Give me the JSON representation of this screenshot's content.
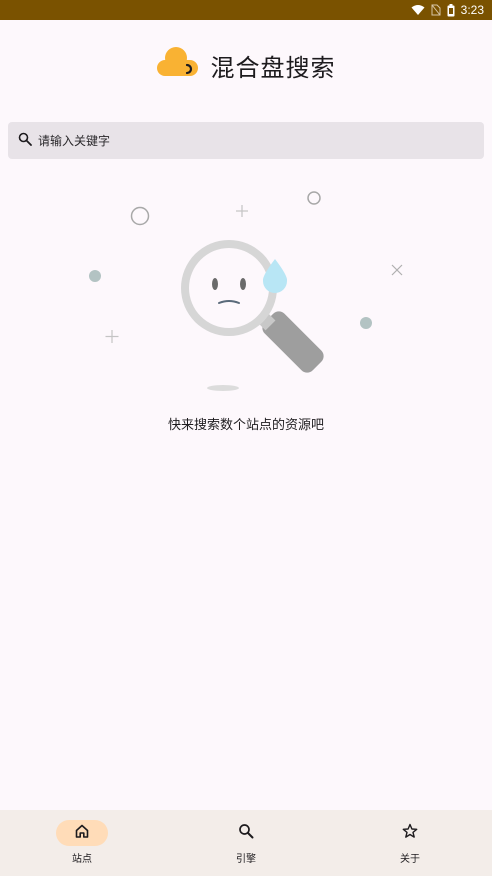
{
  "status_bar": {
    "time": "3:23",
    "icons": [
      "wifi-icon",
      "no-sim-icon",
      "battery-icon"
    ]
  },
  "header": {
    "title": "混合盘搜索",
    "logo_icon": "cloud-logo-icon"
  },
  "search": {
    "placeholder": "请输入关键字",
    "value": "",
    "icon": "search-icon"
  },
  "empty_state": {
    "message": "快来搜索数个站点的资源吧",
    "illustration": "sad-magnifier-illustration"
  },
  "bottom_nav": {
    "items": [
      {
        "label": "站点",
        "icon": "home-icon",
        "active": true
      },
      {
        "label": "引擎",
        "icon": "search-icon",
        "active": false
      },
      {
        "label": "关于",
        "icon": "star-icon",
        "active": false
      }
    ]
  },
  "colors": {
    "status_bar": "#7a5200",
    "background": "#fdf8fc",
    "search_bg": "#e8e3e8",
    "nav_bg": "#f3ede9",
    "nav_active_pill": "#ffdcb8",
    "logo": "#f9b233"
  }
}
